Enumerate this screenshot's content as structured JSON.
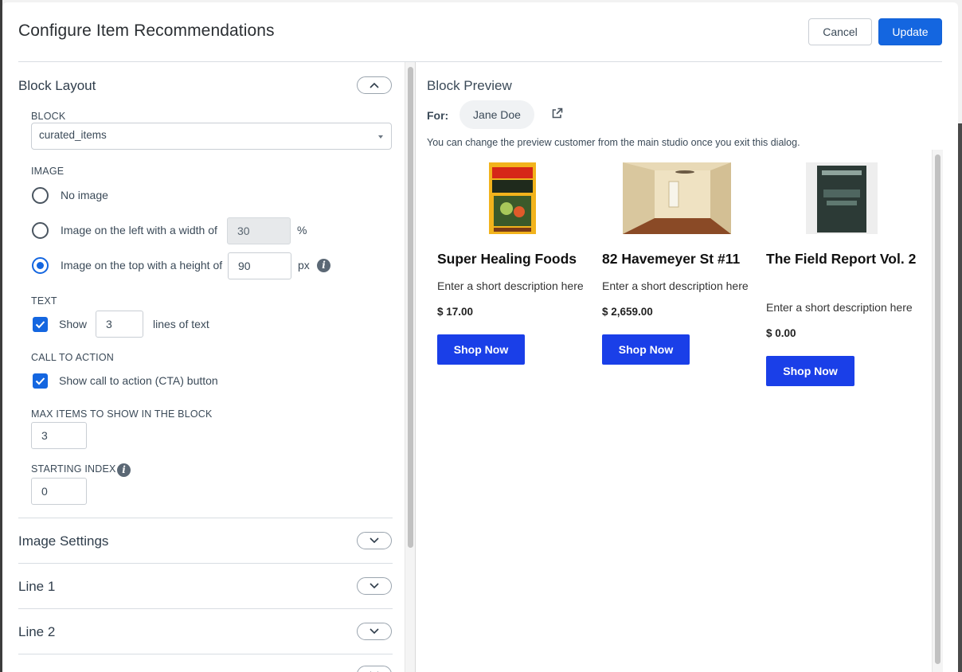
{
  "dialog": {
    "title": "Configure Item Recommendations",
    "cancel_label": "Cancel",
    "update_label": "Update"
  },
  "block_layout": {
    "title": "Block Layout",
    "block_label": "BLOCK",
    "block_value": "curated_items",
    "image_label": "IMAGE",
    "image_options": [
      {
        "label": "No image",
        "selected": false
      },
      {
        "label": "Image on the left with a width of",
        "value": "30",
        "unit": "%",
        "selected": false
      },
      {
        "label": "Image on the top with a height of",
        "value": "90",
        "unit": "px",
        "selected": true
      }
    ],
    "text_label": "TEXT",
    "text_show_label": "Show",
    "text_lines_value": "3",
    "text_lines_suffix": "lines of text",
    "cta_label": "CALL TO ACTION",
    "cta_checkbox_label": "Show call to action (CTA) button",
    "max_items_label": "MAX ITEMS TO SHOW IN THE BLOCK",
    "max_items_value": "3",
    "starting_index_label": "STARTING INDEX",
    "starting_index_value": "0"
  },
  "collapsed_sections": [
    "Image Settings",
    "Line 1",
    "Line 2"
  ],
  "preview": {
    "title": "Block Preview",
    "for_label": "For:",
    "customer": "Jane Doe",
    "note": "You can change the preview customer from the main studio once you exit this dialog.",
    "items": [
      {
        "name": "Super Healing Foods",
        "description": "Enter a short description here",
        "price": "$ 17.00",
        "cta": "Shop Now"
      },
      {
        "name": "82 Havemeyer St #11",
        "description": "Enter a short description here",
        "price": "$ 2,659.00",
        "cta": "Shop Now"
      },
      {
        "name": "The Field Report Vol. 2",
        "description": "Enter a short description here",
        "price": "$ 0.00",
        "cta": "Shop Now"
      }
    ]
  },
  "colors": {
    "primary": "#1466e0",
    "shop_button": "#1a3fe8"
  }
}
